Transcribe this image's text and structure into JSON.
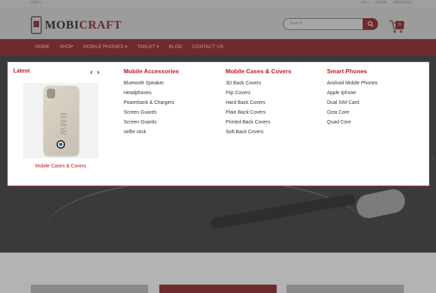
{
  "topbar": {
    "currency": "USD ▾",
    "links": [
      "EN ▾",
      "LOGIN",
      "REGISTER"
    ]
  },
  "header": {
    "logo_first": "MOBI",
    "logo_second": "CRAFT",
    "search_placeholder": "Search",
    "cart_count": "0"
  },
  "nav": {
    "items": [
      "HOME",
      "SHOP",
      "MOBILE PHONES ▾",
      "TABLET ▾",
      "BLOG",
      "CONTACT US"
    ]
  },
  "mega": {
    "latest_label": "Latest",
    "prev_arrow": "‹",
    "next_arrow": "›",
    "product_caption": "Mobile Cases & Covers",
    "product_emboss": "BMW",
    "columns": [
      {
        "title": "Mobile Accessories",
        "items": [
          "Bluetooth Speaker",
          "Headphones",
          "Powerbank & Chargers",
          "Screen Guards",
          "Screen Guards",
          "selfie stick"
        ]
      },
      {
        "title": "Mobile Cases & Covers",
        "items": [
          "3D Back Covers",
          "Flip Covers",
          "Hard Back Covers",
          "Plain Back Covers",
          "Printed Back Covers",
          "Soft Back Covers"
        ]
      },
      {
        "title": "Smart Phones",
        "items": [
          "Android Mobile Phones",
          "Apple Iphone",
          "Dual SIM Card",
          "Octa Core",
          "Quad Core"
        ]
      }
    ]
  },
  "colors": {
    "brand": "#6e2a2d",
    "accent_red": "#c0151b"
  },
  "icons": [
    "search-icon",
    "cart-icon",
    "chevron-left-icon",
    "chevron-right-icon"
  ]
}
